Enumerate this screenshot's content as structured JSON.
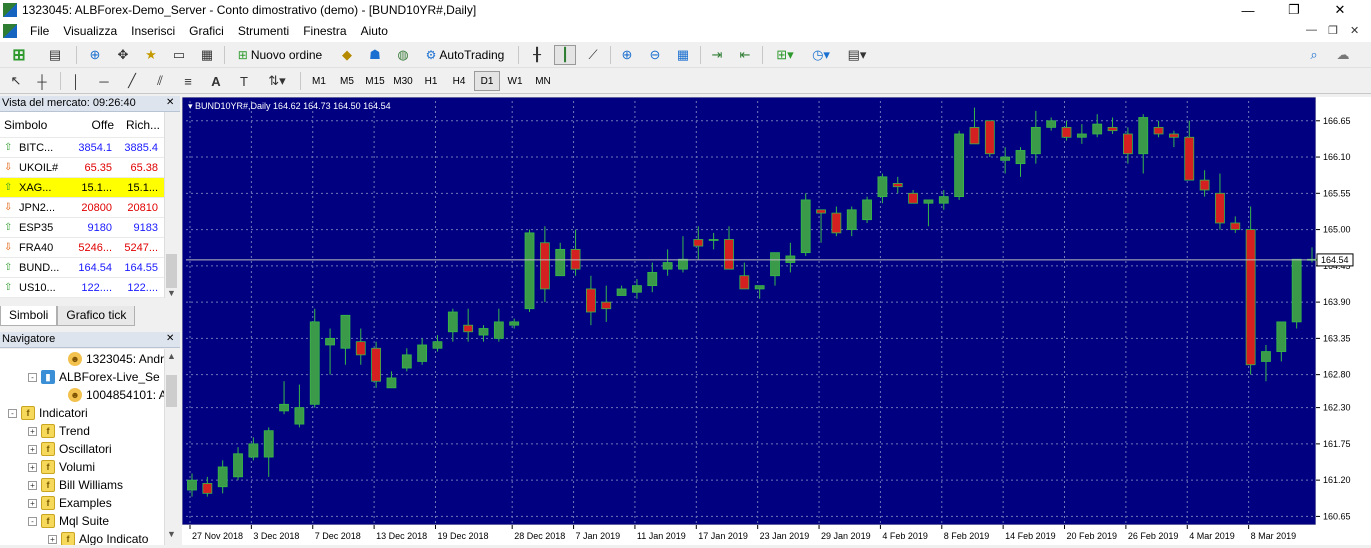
{
  "window": {
    "title": "1323045: ALBForex-Demo_Server - Conto dimostrativo (demo) - [BUND10YR#,Daily]",
    "minimize_glyph": "—",
    "maximize_glyph": "❐",
    "close_glyph": "✕"
  },
  "menu": {
    "items": [
      "File",
      "Visualizza",
      "Inserisci",
      "Grafici",
      "Strumenti",
      "Finestra",
      "Aiuto"
    ],
    "mdi_min": "—",
    "mdi_restore": "❐",
    "mdi_close": "✕"
  },
  "toolbar": {
    "new_order_label": "Nuovo ordine",
    "autotrading_label": "AutoTrading",
    "timeframes": [
      "M1",
      "M5",
      "M15",
      "M30",
      "H1",
      "H4",
      "D1",
      "W1",
      "MN"
    ],
    "active_timeframe": "D1"
  },
  "market_watch": {
    "title": "Vista del mercato: 09:26:40",
    "columns": [
      "Simbolo",
      "Offe",
      "Rich..."
    ],
    "rows": [
      {
        "symbol": "BITC...",
        "bid": "3854.1",
        "ask": "3885.4",
        "dir": "up",
        "color": "#1a1aff"
      },
      {
        "symbol": "UKOIL#",
        "bid": "65.35",
        "ask": "65.38",
        "dir": "down",
        "color": "#e00000"
      },
      {
        "symbol": "XAG...",
        "bid": "15.1...",
        "ask": "15.1...",
        "dir": "up",
        "color": "#000000",
        "highlight": true
      },
      {
        "symbol": "JPN2...",
        "bid": "20800",
        "ask": "20810",
        "dir": "down",
        "color": "#e00000"
      },
      {
        "symbol": "ESP35",
        "bid": "9180",
        "ask": "9183",
        "dir": "up",
        "color": "#1a1aff"
      },
      {
        "symbol": "FRA40",
        "bid": "5246...",
        "ask": "5247...",
        "dir": "down",
        "color": "#e00000"
      },
      {
        "symbol": "BUND...",
        "bid": "164.54",
        "ask": "164.55",
        "dir": "up",
        "color": "#1a1aff"
      },
      {
        "symbol": "US10...",
        "bid": "122....",
        "ask": "122....",
        "dir": "up",
        "color": "#1a1aff"
      }
    ],
    "tabs": [
      "Simboli",
      "Grafico tick"
    ]
  },
  "navigator": {
    "title": "Navigatore",
    "close_glyph": "✕",
    "items": [
      {
        "label": "1323045: Andr",
        "indent": 68,
        "icon": "u"
      },
      {
        "label": "ALBForex-Live_Se",
        "indent": 30,
        "icon": "s",
        "expander": "-"
      },
      {
        "label": "1004854101: A",
        "indent": 68,
        "icon": "u"
      },
      {
        "label": "Indicatori",
        "indent": 10,
        "icon": "f",
        "expander": "-"
      },
      {
        "label": "Trend",
        "indent": 30,
        "icon": "f",
        "expander": "+"
      },
      {
        "label": "Oscillatori",
        "indent": 30,
        "icon": "f",
        "expander": "+"
      },
      {
        "label": "Volumi",
        "indent": 30,
        "icon": "f",
        "expander": "+"
      },
      {
        "label": "Bill Williams",
        "indent": 30,
        "icon": "f",
        "expander": "+"
      },
      {
        "label": "Examples",
        "indent": 30,
        "icon": "f",
        "expander": "+"
      },
      {
        "label": "Mql Suite",
        "indent": 30,
        "icon": "f",
        "expander": "-"
      },
      {
        "label": "Algo Indicato",
        "indent": 50,
        "icon": "f",
        "expander": "+"
      }
    ]
  },
  "chart_header": {
    "label": "BUND10YR#,Daily  164.62 164.73 164.50 164.54"
  },
  "colors": {
    "chart_bg": "#000080",
    "bull": "#3a9a4a",
    "bear": "#d42020",
    "wick": "#38b848",
    "grid": "#6e7ab8",
    "price_line": "#c0c0c0"
  },
  "chart_data": {
    "type": "candlestick",
    "symbol": "BUND10YR#",
    "timeframe": "Daily",
    "y_ticks": [
      160.65,
      161.2,
      161.75,
      162.3,
      162.8,
      163.35,
      163.9,
      164.45,
      165.0,
      165.55,
      166.1,
      166.65
    ],
    "ylim": [
      160.55,
      166.95
    ],
    "x_tick_labels": [
      "27 Nov 2018",
      "3 Dec 2018",
      "7 Dec 2018",
      "13 Dec 2018",
      "19 Dec 2018",
      "28 Dec 2018",
      "7 Jan 2019",
      "11 Jan 2019",
      "17 Jan 2019",
      "23 Jan 2019",
      "29 Jan 2019",
      "4 Feb 2019",
      "8 Feb 2019",
      "14 Feb 2019",
      "20 Feb 2019",
      "26 Feb 2019",
      "4 Mar 2019",
      "8 Mar 2019"
    ],
    "x_tick_index": [
      0,
      4,
      8,
      12,
      16,
      21,
      25,
      29,
      33,
      37,
      41,
      45,
      49,
      53,
      57,
      61,
      65,
      69
    ],
    "current_price": "164.54",
    "current_price_value": 164.54,
    "ohlc": [
      [
        161.05,
        161.3,
        160.95,
        161.2
      ],
      [
        161.15,
        161.25,
        160.95,
        161.0
      ],
      [
        161.1,
        161.5,
        161.0,
        161.4
      ],
      [
        161.25,
        161.7,
        161.2,
        161.6
      ],
      [
        161.55,
        161.85,
        161.5,
        161.75
      ],
      [
        161.55,
        162.0,
        161.25,
        161.95
      ],
      [
        162.25,
        162.7,
        162.2,
        162.35
      ],
      [
        162.05,
        162.65,
        162.0,
        162.3
      ],
      [
        162.35,
        163.8,
        162.3,
        163.6
      ],
      [
        163.25,
        163.5,
        162.8,
        163.35
      ],
      [
        163.2,
        163.65,
        162.95,
        163.7
      ],
      [
        163.3,
        163.5,
        162.95,
        163.1
      ],
      [
        163.2,
        163.3,
        162.6,
        162.7
      ],
      [
        162.6,
        162.85,
        162.6,
        162.75
      ],
      [
        162.9,
        163.2,
        162.85,
        163.1
      ],
      [
        163.0,
        163.35,
        162.95,
        163.25
      ],
      [
        163.2,
        163.4,
        163.15,
        163.3
      ],
      [
        163.45,
        163.8,
        163.3,
        163.75
      ],
      [
        163.55,
        163.8,
        163.3,
        163.45
      ],
      [
        163.4,
        163.55,
        163.3,
        163.5
      ],
      [
        163.35,
        163.8,
        163.3,
        163.6
      ],
      [
        163.55,
        163.65,
        163.5,
        163.6
      ],
      [
        163.8,
        165.0,
        163.75,
        164.95
      ],
      [
        164.8,
        165.05,
        163.9,
        164.1
      ],
      [
        164.3,
        164.8,
        164.3,
        164.7
      ],
      [
        164.7,
        165.0,
        164.3,
        164.4
      ],
      [
        164.1,
        164.3,
        163.55,
        163.75
      ],
      [
        163.9,
        164.15,
        163.6,
        163.8
      ],
      [
        164.0,
        164.15,
        164.0,
        164.1
      ],
      [
        164.05,
        164.25,
        163.95,
        164.15
      ],
      [
        164.15,
        164.5,
        164.05,
        164.35
      ],
      [
        164.4,
        164.7,
        164.3,
        164.5
      ],
      [
        164.4,
        164.9,
        164.35,
        164.55
      ],
      [
        164.85,
        165.05,
        164.55,
        164.75
      ],
      [
        164.85,
        164.95,
        164.7,
        164.85
      ],
      [
        164.85,
        165.05,
        164.55,
        164.4
      ],
      [
        164.3,
        164.5,
        164.1,
        164.1
      ],
      [
        164.1,
        164.15,
        163.95,
        164.15
      ],
      [
        164.3,
        164.55,
        164.15,
        164.65
      ],
      [
        164.5,
        164.8,
        164.35,
        164.6
      ],
      [
        164.65,
        165.55,
        164.6,
        165.45
      ],
      [
        165.3,
        165.25,
        164.8,
        165.25
      ],
      [
        165.25,
        165.35,
        164.9,
        164.95
      ],
      [
        165.0,
        165.35,
        164.9,
        165.3
      ],
      [
        165.15,
        165.5,
        165.1,
        165.45
      ],
      [
        165.5,
        165.85,
        165.4,
        165.8
      ],
      [
        165.7,
        165.8,
        165.55,
        165.65
      ],
      [
        165.55,
        165.6,
        165.45,
        165.4
      ],
      [
        165.4,
        165.45,
        165.05,
        165.45
      ],
      [
        165.4,
        165.6,
        165.3,
        165.5
      ],
      [
        165.5,
        166.5,
        165.45,
        166.45
      ],
      [
        166.55,
        166.85,
        166.3,
        166.3
      ],
      [
        166.65,
        166.5,
        166.1,
        166.15
      ],
      [
        166.05,
        166.25,
        165.85,
        166.1
      ],
      [
        166.0,
        166.25,
        165.8,
        166.2
      ],
      [
        166.15,
        166.8,
        166.0,
        166.55
      ],
      [
        166.55,
        166.7,
        166.5,
        166.65
      ],
      [
        166.55,
        166.65,
        166.35,
        166.4
      ],
      [
        166.4,
        166.6,
        166.3,
        166.45
      ],
      [
        166.45,
        166.75,
        166.4,
        166.6
      ],
      [
        166.55,
        166.7,
        166.45,
        166.5
      ],
      [
        166.45,
        166.55,
        166.0,
        166.15
      ],
      [
        166.15,
        166.75,
        165.85,
        166.7
      ],
      [
        166.55,
        166.65,
        166.4,
        166.45
      ],
      [
        166.45,
        166.5,
        166.25,
        166.4
      ],
      [
        166.4,
        166.65,
        166.2,
        165.75
      ],
      [
        165.75,
        165.9,
        165.5,
        165.6
      ],
      [
        165.55,
        165.85,
        165.0,
        165.1
      ],
      [
        165.1,
        165.2,
        164.95,
        165.0
      ],
      [
        165.0,
        165.35,
        162.8,
        162.95
      ],
      [
        163.0,
        163.25,
        162.7,
        163.15
      ],
      [
        163.15,
        163.6,
        163.0,
        163.6
      ],
      [
        163.6,
        164.55,
        163.5,
        164.55
      ],
      [
        164.55,
        164.73,
        164.5,
        164.54
      ]
    ]
  }
}
